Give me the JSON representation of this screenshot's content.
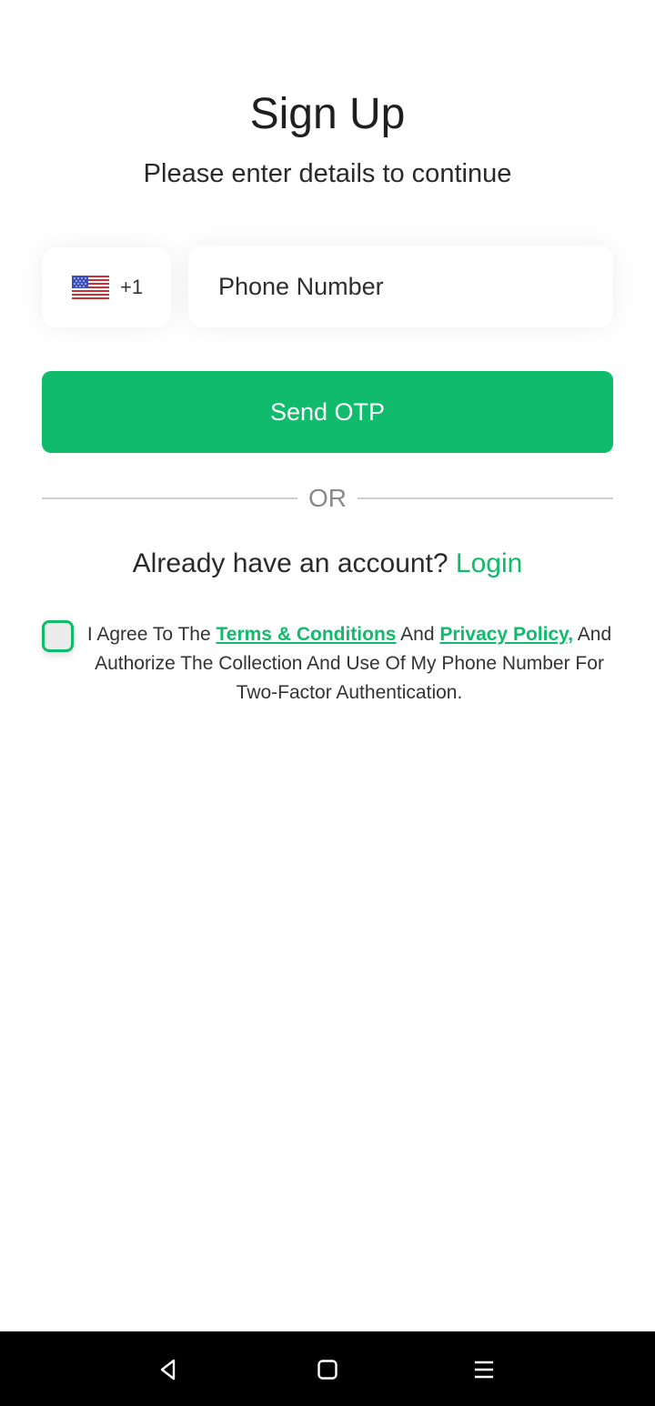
{
  "header": {
    "title": "Sign Up",
    "subtitle": "Please enter details to continue"
  },
  "phone": {
    "country_flag": "us-flag-icon",
    "dial_code": "+1",
    "placeholder": "Phone Number",
    "value": ""
  },
  "actions": {
    "send_otp_label": "Send OTP",
    "divider_label": "OR"
  },
  "login": {
    "prompt": "Already have an account?",
    "link_label": "Login"
  },
  "consent": {
    "checked": false,
    "text_prefix": "I Agree To The",
    "terms_label": "Terms & Conditions",
    "text_and": "And",
    "privacy_label": "Privacy Policy,",
    "text_suffix": "And Authorize The Collection And Use Of My Phone Number For Two-Factor Authentication."
  },
  "system_nav": {
    "back": "back-icon",
    "home": "home-icon",
    "recents": "menu-icon"
  },
  "colors": {
    "accent": "#10bb6c",
    "text": "#2a2a2a",
    "divider": "#cfcfcf",
    "nav_bar": "#000000"
  }
}
